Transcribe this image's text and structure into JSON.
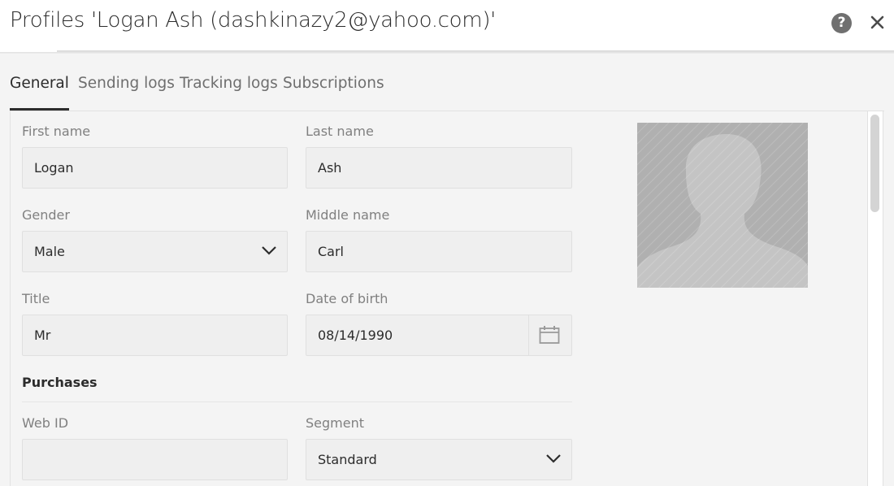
{
  "window": {
    "title": "Profiles 'Logan Ash (dashkinazy2@yahoo.com)'",
    "help_icon": "help-icon",
    "close_icon": "close-icon",
    "help_glyph": "?"
  },
  "tabs": [
    {
      "label": "General",
      "active": true
    },
    {
      "label": "Sending logs",
      "active": false
    },
    {
      "label": "Tracking logs",
      "active": false
    },
    {
      "label": "Subscriptions",
      "active": false
    }
  ],
  "form": {
    "first_name": {
      "label": "First name",
      "value": "Logan"
    },
    "last_name": {
      "label": "Last name",
      "value": "Ash"
    },
    "gender": {
      "label": "Gender",
      "value": "Male"
    },
    "middle_name": {
      "label": "Middle name",
      "value": "Carl"
    },
    "title": {
      "label": "Title",
      "value": "Mr"
    },
    "date_of_birth": {
      "label": "Date of birth",
      "value": "08/14/1990",
      "icon": "calendar-icon"
    },
    "purchases_section": "Purchases",
    "web_id": {
      "label": "Web ID",
      "value": ""
    },
    "segment": {
      "label": "Segment",
      "value": "Standard"
    }
  },
  "avatar": {
    "icon": "profile-silhouette-icon"
  },
  "colors": {
    "text": "#2c2c2c",
    "label": "#808080",
    "field_bg": "#efefef",
    "page_bg": "#f4f4f4"
  }
}
